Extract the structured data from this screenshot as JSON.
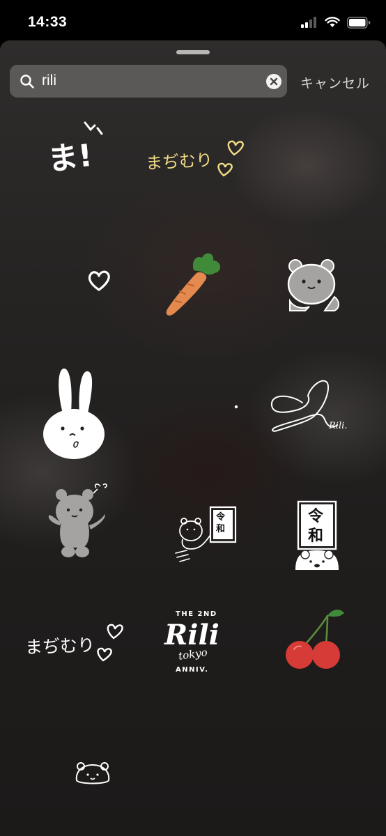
{
  "status_bar": {
    "time": "14:33",
    "signal_icon": "cellular-signal-icon",
    "wifi_icon": "wifi-icon",
    "battery_icon": "battery-icon"
  },
  "search": {
    "query": "rili",
    "icon": "search-icon",
    "clear_icon": "clear-icon",
    "cancel_label": "キャンセル"
  },
  "stickers": [
    {
      "name": "ma-exclaim-sticker",
      "text": "ま!"
    },
    {
      "name": "machimuri-yellow-sticker",
      "text": "まぢむり"
    },
    {
      "name": "small-heart-sticker"
    },
    {
      "name": "carrot-sticker"
    },
    {
      "name": "gray-bear-face-sticker"
    },
    {
      "name": "white-bunny-sticker"
    },
    {
      "name": "dot-sticker"
    },
    {
      "name": "heart-rili-scribble-sticker",
      "text": "Rili."
    },
    {
      "name": "gray-bear-waving-sticker"
    },
    {
      "name": "bear-holding-reiwa-sign-sticker",
      "text": "令和"
    },
    {
      "name": "reiwa-sign-bear-sticker",
      "text": "令和"
    },
    {
      "name": "machimuri-white-sticker",
      "text": "まぢむり"
    },
    {
      "name": "rili-tokyo-2nd-anniv-sticker",
      "text_top": "THE 2ND",
      "text_logo": "Rili",
      "text_script": "tokyo",
      "text_bottom": "ANNIV."
    },
    {
      "name": "cherry-sticker"
    },
    {
      "name": "bear-outline-face-sticker"
    }
  ],
  "colors": {
    "background": "#000000",
    "sheet": "#262423",
    "search_field": "#7a7876",
    "yellow_text": "#f0dd86",
    "carrot": "#e58a4f",
    "leaf": "#3f8b3a",
    "cherry": "#d63b37",
    "bear_gray": "#a5a3a1"
  }
}
